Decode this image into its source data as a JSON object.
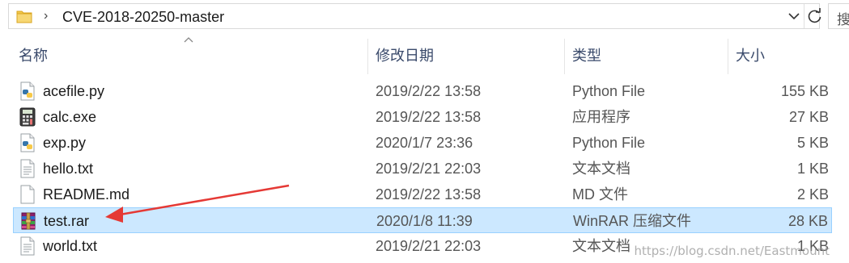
{
  "address_bar": {
    "path": "CVE-2018-20250-master",
    "folder_icon": "folder-icon",
    "dropdown_icon": "chevron-down-icon",
    "refresh_icon": "refresh-icon"
  },
  "search": {
    "placeholder": "搜"
  },
  "columns": {
    "name": "名称",
    "date": "修改日期",
    "type": "类型",
    "size": "大小"
  },
  "files": [
    {
      "name": "acefile.py",
      "date": "2019/2/22 13:58",
      "type": "Python File",
      "size": "155 KB",
      "icon": "python-file-icon"
    },
    {
      "name": "calc.exe",
      "date": "2019/2/22 13:58",
      "type": "应用程序",
      "size": "27 KB",
      "icon": "calculator-exe-icon"
    },
    {
      "name": "exp.py",
      "date": "2020/1/7 23:36",
      "type": "Python File",
      "size": "5 KB",
      "icon": "python-file-icon"
    },
    {
      "name": "hello.txt",
      "date": "2019/2/21 22:03",
      "type": "文本文档",
      "size": "1 KB",
      "icon": "text-file-icon"
    },
    {
      "name": "README.md",
      "date": "2019/2/22 13:58",
      "type": "MD 文件",
      "size": "2 KB",
      "icon": "blank-file-icon"
    },
    {
      "name": "test.rar",
      "date": "2020/1/8 11:39",
      "type": "WinRAR 压缩文件",
      "size": "28 KB",
      "icon": "winrar-archive-icon",
      "selected": true
    },
    {
      "name": "world.txt",
      "date": "2019/2/21 22:03",
      "type": "文本文档",
      "size": "1 KB",
      "icon": "text-file-icon"
    }
  ],
  "colors": {
    "selection_bg": "#cce8ff",
    "selection_border": "#99d1ff",
    "annotation_arrow": "#e53935",
    "header_text": "#3a4a6b"
  },
  "watermark": "https://blog.csdn.net/Eastmount"
}
